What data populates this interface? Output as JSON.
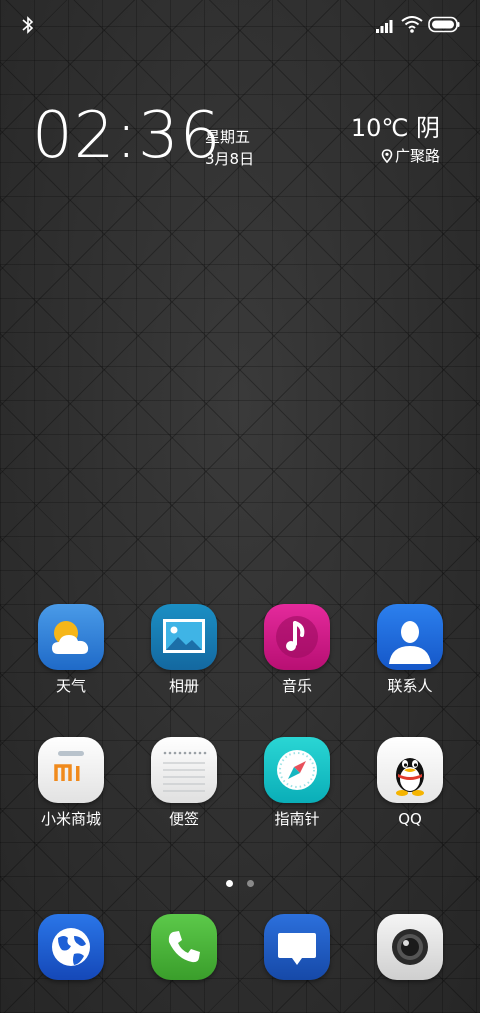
{
  "status_bar": {
    "icons": [
      "bluetooth-icon",
      "signal-icon",
      "wifi-icon",
      "battery-icon"
    ]
  },
  "clock": {
    "time": "02:36",
    "weekday": "星期五",
    "date": "3月8日"
  },
  "weather": {
    "summary": "10℃  阴",
    "location": "广聚路",
    "icon": "location-pin-icon"
  },
  "apps": [
    {
      "label": "天气",
      "icon": "weather-icon",
      "color": "#2f7fd8"
    },
    {
      "label": "相册",
      "icon": "gallery-icon",
      "color": "#1a9ad6"
    },
    {
      "label": "音乐",
      "icon": "music-icon",
      "color": "#d8178c"
    },
    {
      "label": "联系人",
      "icon": "contacts-icon",
      "color": "#1e6fe0"
    },
    {
      "label": "小米商城",
      "icon": "mi-store-icon",
      "color": "#f2f2f2"
    },
    {
      "label": "便签",
      "icon": "notes-icon",
      "color": "#f0f0f0"
    },
    {
      "label": "指南针",
      "icon": "compass-icon",
      "color": "#18c4c8"
    },
    {
      "label": "QQ",
      "icon": "qq-icon",
      "color": "#ffffff"
    }
  ],
  "page_indicator": {
    "count": 2,
    "active": 1
  },
  "dock": [
    {
      "icon": "browser-icon",
      "color": "#1d5fd6"
    },
    {
      "icon": "phone-icon",
      "color": "#4bb83a"
    },
    {
      "icon": "messages-icon",
      "color": "#1e5fc8"
    },
    {
      "icon": "camera-icon",
      "color": "#e8e8e8"
    }
  ]
}
